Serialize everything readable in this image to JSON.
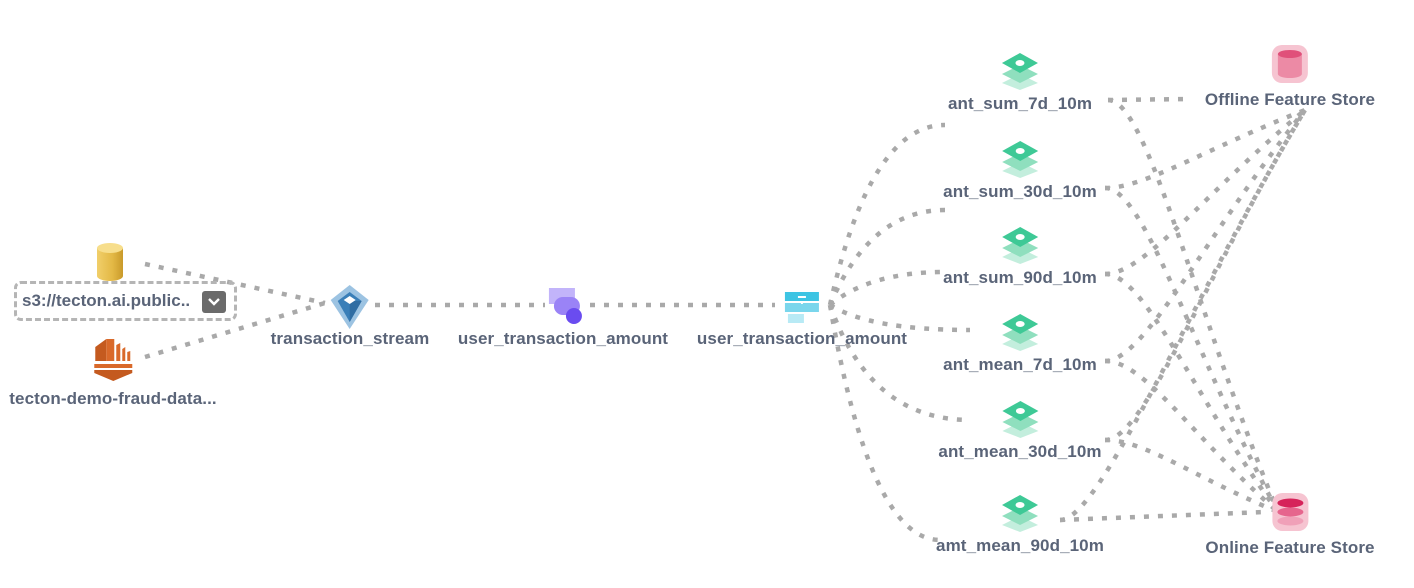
{
  "diagram": {
    "edge_color": "#a9a9a9",
    "data_sources": {
      "batch": {
        "label": "s3://tecton.ai.public..",
        "icon": "s3-bucket-icon",
        "color": "#e2b84b",
        "expand_icon": "chevron-down-icon"
      },
      "stream": {
        "label": "tecton-demo-fraud-data...",
        "icon": "kinesis-stream-icon",
        "color": "#d9692a"
      }
    },
    "stream_source": {
      "label": "transaction_stream",
      "icon": "stream-source-icon",
      "color": "#3a7fb8"
    },
    "transformation": {
      "label": "user_transaction_amount",
      "icon": "transformation-icon",
      "color": "#6a4cf0"
    },
    "entity": {
      "label": "user_transaction_amount",
      "icon": "feature-view-icon",
      "color": "#3dc4e3"
    },
    "features": [
      {
        "label": "ant_sum_7d_10m"
      },
      {
        "label": "ant_sum_30d_10m"
      },
      {
        "label": "ant_sum_90d_10m"
      },
      {
        "label": "ant_mean_7d_10m"
      },
      {
        "label": "ant_mean_30d_10m"
      },
      {
        "label": "amt_mean_90d_10m"
      }
    ],
    "feature_icon": "feature-layers-icon",
    "feature_color": "#3ec996",
    "stores": {
      "offline": {
        "label": "Offline Feature Store",
        "icon": "offline-store-icon",
        "color": "#e5517a"
      },
      "online": {
        "label": "Online Feature Store",
        "icon": "online-store-icon",
        "color": "#d6235a"
      }
    },
    "edges": [
      [
        "batch",
        "stream_source"
      ],
      [
        "stream",
        "stream_source"
      ],
      [
        "stream_source",
        "transformation"
      ],
      [
        "transformation",
        "entity"
      ],
      [
        "entity",
        "feature-0"
      ],
      [
        "entity",
        "feature-1"
      ],
      [
        "entity",
        "feature-2"
      ],
      [
        "entity",
        "feature-3"
      ],
      [
        "entity",
        "feature-4"
      ],
      [
        "entity",
        "feature-5"
      ],
      [
        "feature-0",
        "offline"
      ],
      [
        "feature-0",
        "online"
      ],
      [
        "feature-1",
        "offline"
      ],
      [
        "feature-1",
        "online"
      ],
      [
        "feature-2",
        "offline"
      ],
      [
        "feature-2",
        "online"
      ],
      [
        "feature-3",
        "offline"
      ],
      [
        "feature-3",
        "online"
      ],
      [
        "feature-4",
        "offline"
      ],
      [
        "feature-4",
        "online"
      ],
      [
        "feature-5",
        "offline"
      ],
      [
        "feature-5",
        "online"
      ]
    ]
  }
}
